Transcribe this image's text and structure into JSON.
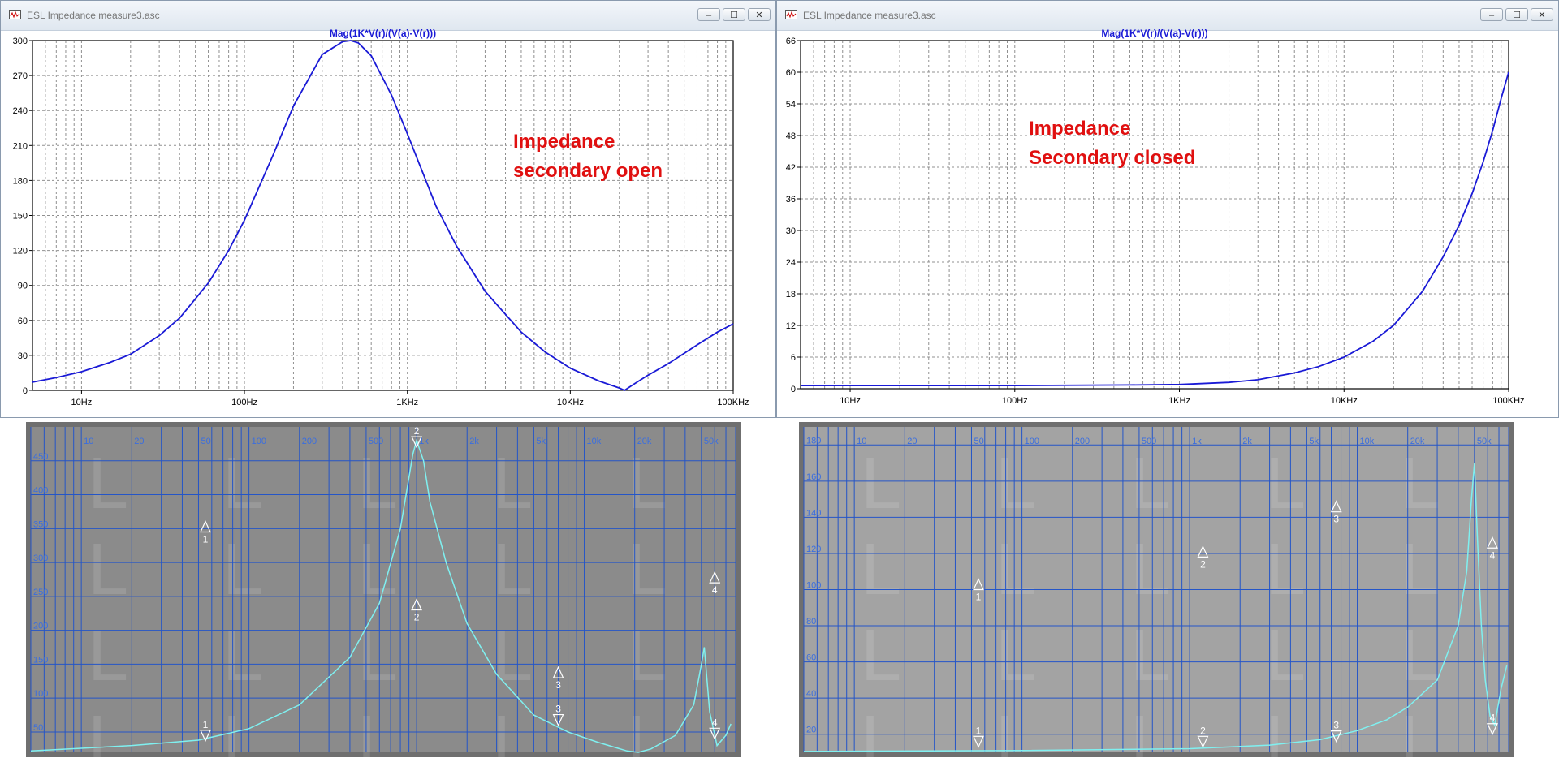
{
  "windows": [
    {
      "title": "ESL Impedance measure3.asc",
      "controls": {
        "minimize": "–",
        "maximize": "☐",
        "close": "✕"
      },
      "annotation": [
        "Impedance",
        "secondary open"
      ]
    },
    {
      "title": "ESL Impedance measure3.asc",
      "controls": {
        "minimize": "–",
        "maximize": "☐",
        "close": "✕"
      },
      "annotation": [
        "Impedance",
        "Secondary closed"
      ]
    }
  ],
  "colors": {
    "trace": "#1a1ad6",
    "annotation": "#e01010",
    "plot_grid": "#909090",
    "analyzer_bg": "#8b8b8b",
    "analyzer_bg_right": "#a3a3a3",
    "analyzer_grid": "#2455c8",
    "analyzer_trace": "#7ff0f0"
  },
  "chart_data": [
    {
      "type": "line",
      "title": "Mag(1K*V(r)/(V(a)-V(r)))",
      "xscale": "log",
      "xlim": [
        5,
        100000
      ],
      "ylim": [
        0,
        300
      ],
      "xticks": [
        10,
        100,
        1000,
        10000,
        100000
      ],
      "xtick_labels": [
        "10Hz",
        "100Hz",
        "1KHz",
        "10KHz",
        "100KHz"
      ],
      "yticks": [
        0,
        30,
        60,
        90,
        120,
        150,
        180,
        210,
        240,
        270,
        300
      ],
      "grid": true,
      "series": [
        {
          "x": [
            5,
            7,
            10,
            15,
            20,
            30,
            40,
            60,
            80,
            100,
            150,
            200,
            300,
            400,
            450,
            500,
            600,
            800,
            1000,
            1500,
            2000,
            3000,
            5000,
            7000,
            10000,
            15000,
            20000,
            21500,
            25000,
            30000,
            40000,
            60000,
            80000,
            100000
          ],
          "y": [
            7,
            11,
            16,
            24,
            31,
            47,
            62,
            92,
            120,
            146,
            202,
            244,
            288,
            299,
            300,
            298,
            287,
            253,
            220,
            158,
            124,
            85,
            50,
            33,
            19,
            8,
            2,
            0,
            6,
            13,
            23,
            39,
            50,
            57
          ]
        }
      ]
    },
    {
      "type": "line",
      "title": "Mag(1K*V(r)/(V(a)-V(r)))",
      "xscale": "log",
      "xlim": [
        5,
        100000
      ],
      "ylim": [
        0,
        66
      ],
      "xticks": [
        10,
        100,
        1000,
        10000,
        100000
      ],
      "xtick_labels": [
        "10Hz",
        "100Hz",
        "1KHz",
        "10KHz",
        "100KHz"
      ],
      "yticks": [
        0,
        6,
        12,
        18,
        24,
        30,
        36,
        42,
        48,
        54,
        60,
        66
      ],
      "grid": true,
      "series": [
        {
          "x": [
            5,
            10,
            100,
            500,
            1000,
            2000,
            3000,
            5000,
            7000,
            10000,
            15000,
            20000,
            30000,
            40000,
            50000,
            60000,
            70000,
            80000,
            90000,
            100000
          ],
          "y": [
            0.6,
            0.6,
            0.6,
            0.7,
            0.8,
            1.2,
            1.7,
            3.0,
            4.2,
            6.0,
            9.0,
            12.0,
            18.5,
            25.0,
            31.0,
            37.0,
            43.0,
            49.0,
            55.0,
            60.0
          ]
        }
      ]
    },
    {
      "type": "line",
      "xscale": "log",
      "xlim": [
        5,
        80000
      ],
      "ylim": [
        20,
        500
      ],
      "xtick_labels": [
        "10",
        "20",
        "50",
        "100",
        "200",
        "500",
        "1k",
        "2k",
        "5k",
        "10k",
        "20k",
        "50k"
      ],
      "xticks": [
        10,
        20,
        50,
        100,
        200,
        500,
        1000,
        2000,
        5000,
        10000,
        20000,
        50000
      ],
      "yticks": [
        50,
        100,
        150,
        200,
        250,
        300,
        350,
        400,
        450
      ],
      "grid": true,
      "markers": [
        {
          "label": "1",
          "x": 55,
          "y": 37,
          "dir": "down"
        },
        {
          "label": "1",
          "x": 55,
          "y": 345,
          "dir": "up"
        },
        {
          "label": "2",
          "x": 1000,
          "y": 470,
          "dir": "down"
        },
        {
          "label": "2",
          "x": 1000,
          "y": 230,
          "dir": "up"
        },
        {
          "label": "3",
          "x": 7000,
          "y": 60,
          "dir": "down"
        },
        {
          "label": "3",
          "x": 7000,
          "y": 130,
          "dir": "up"
        },
        {
          "label": "4",
          "x": 60000,
          "y": 40,
          "dir": "down"
        },
        {
          "label": "4",
          "x": 60000,
          "y": 270,
          "dir": "up"
        }
      ],
      "series": [
        {
          "x": [
            5,
            10,
            20,
            50,
            100,
            200,
            400,
            600,
            800,
            950,
            1000,
            1100,
            1200,
            1500,
            2000,
            3000,
            5000,
            8000,
            12000,
            18000,
            21000,
            25000,
            35000,
            45000,
            50000,
            52000,
            56000,
            62000,
            70000,
            75000
          ],
          "y": [
            22,
            26,
            30,
            38,
            55,
            90,
            160,
            240,
            350,
            460,
            480,
            450,
            390,
            300,
            210,
            135,
            75,
            50,
            35,
            22,
            20,
            25,
            45,
            90,
            150,
            175,
            80,
            30,
            45,
            62
          ]
        }
      ]
    },
    {
      "type": "line",
      "xscale": "log",
      "xlim": [
        5,
        80000
      ],
      "ylim": [
        10,
        190
      ],
      "xtick_labels": [
        "10",
        "20",
        "50",
        "100",
        "200",
        "500",
        "1k",
        "2k",
        "5k",
        "10k",
        "20k",
        "50k"
      ],
      "xticks": [
        10,
        20,
        50,
        100,
        200,
        500,
        1000,
        2000,
        5000,
        10000,
        20000,
        50000
      ],
      "yticks": [
        20,
        40,
        60,
        80,
        100,
        120,
        140,
        160,
        180
      ],
      "grid": true,
      "markers": [
        {
          "label": "1",
          "x": 55,
          "y": 13,
          "dir": "down"
        },
        {
          "label": "1",
          "x": 55,
          "y": 100,
          "dir": "up"
        },
        {
          "label": "2",
          "x": 1200,
          "y": 13,
          "dir": "down"
        },
        {
          "label": "2",
          "x": 1200,
          "y": 118,
          "dir": "up"
        },
        {
          "label": "3",
          "x": 7500,
          "y": 16,
          "dir": "down"
        },
        {
          "label": "3",
          "x": 7500,
          "y": 143,
          "dir": "up"
        },
        {
          "label": "4",
          "x": 64000,
          "y": 20,
          "dir": "down"
        },
        {
          "label": "4",
          "x": 64000,
          "y": 123,
          "dir": "up"
        }
      ],
      "series": [
        {
          "x": [
            5,
            100,
            1000,
            3000,
            6000,
            10000,
            15000,
            20000,
            30000,
            40000,
            45000,
            48000,
            50000,
            52000,
            55000,
            58000,
            62000,
            66000,
            72000,
            78000
          ],
          "y": [
            10.5,
            11,
            12,
            14,
            17,
            22,
            28,
            35,
            50,
            80,
            110,
            150,
            170,
            130,
            80,
            50,
            30,
            25,
            45,
            58
          ]
        }
      ]
    }
  ]
}
